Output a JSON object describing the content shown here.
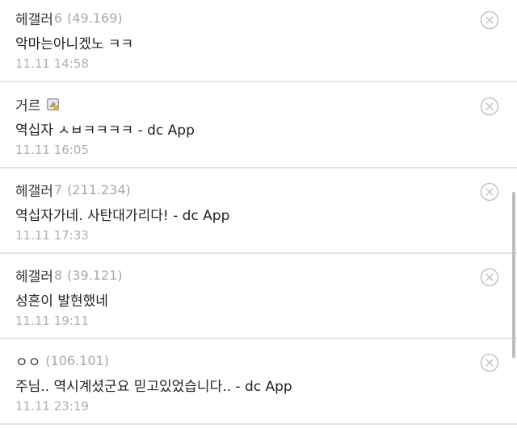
{
  "comments": [
    {
      "nickname": "헤갤러",
      "suffix": "6",
      "ip": "(49.169)",
      "text": "악마는아니겠노 ㅋㅋ",
      "date": "11.11 14:58"
    },
    {
      "nickname": "거르",
      "suffix": "",
      "ip": "",
      "member_icon": "fixed-member-icon",
      "text": "역십자 ㅅㅂㅋㅋㅋㅋ - dc App",
      "date": "11.11 16:05"
    },
    {
      "nickname": "헤갤러",
      "suffix": "7",
      "ip": "(211.234)",
      "text": "역십자가네. 사탄대가리다! - dc App",
      "date": "11.11 17:33"
    },
    {
      "nickname": "헤갤러",
      "suffix": "8",
      "ip": "(39.121)",
      "text": "성흔이 발현했네",
      "date": "11.11 19:11"
    },
    {
      "nickname": "ㅇㅇ",
      "suffix": "",
      "ip": "(106.101)",
      "text": "주님.. 역시계셨군요 믿고있었습니다.. - dc App",
      "date": "11.11 23:19"
    }
  ],
  "icons": {
    "delete": "close-circle-icon",
    "member": "fixed-member-icon"
  },
  "colors": {
    "nickname": "#333333",
    "meta": "#a8a8a8",
    "divider": "#e4e4e4",
    "scrollbar": "#bdbdbd"
  }
}
